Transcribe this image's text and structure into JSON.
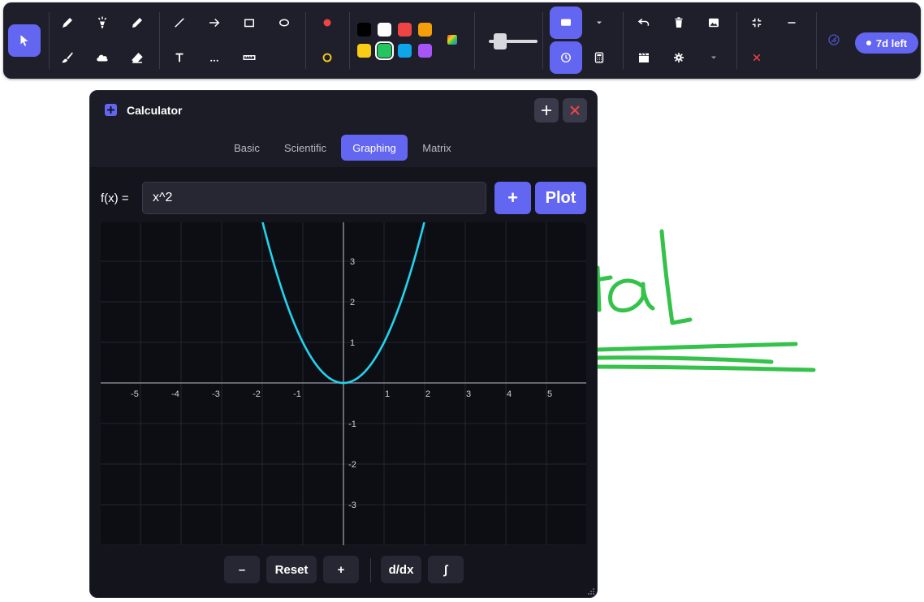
{
  "toolbar": {
    "tools": [
      "select-tool",
      "pen-tool",
      "highlighter-tool",
      "pencil-tool",
      "brush-tool",
      "cloud-tool",
      "eraser-tool",
      "line-tool",
      "arrow-tool",
      "rectangle-tool",
      "ellipse-tool",
      "text-tool",
      "dotted-tool",
      "ruler-tool"
    ],
    "colors": {
      "swatches": [
        "#000000",
        "#ffffff",
        "#ef4444",
        "#f59e0b",
        "#facc15",
        "#22c55e",
        "#0ea5e9",
        "#a855f7"
      ],
      "selected": "#22c55e",
      "accent": "#6366f1"
    },
    "stroke_width_level": 0.15,
    "trial_badge": "7d left"
  },
  "calculator": {
    "title": "Calculator",
    "tabs": [
      "Basic",
      "Scientific",
      "Graphing",
      "Matrix"
    ],
    "active_tab": "Graphing",
    "function_label": "f(x) =",
    "function_value": "x^2",
    "add_label": "+",
    "plot_label": "Plot",
    "controls": {
      "zoom_out": "–",
      "reset": "Reset",
      "zoom_in": "+",
      "derivative": "d/dx",
      "integral": "∫"
    }
  },
  "chart_data": {
    "type": "line",
    "function": "x^2",
    "series": [
      {
        "color": "#22d3ee",
        "x": [
          -2,
          -1.5,
          -1,
          -0.5,
          0,
          0.5,
          1,
          1.5,
          2
        ],
        "y": [
          4,
          2.25,
          1,
          0.25,
          0,
          0.25,
          1,
          2.25,
          4
        ]
      }
    ],
    "xlim": [
      -6,
      6
    ],
    "ylim": [
      -4,
      4
    ],
    "x_ticks": [
      "-5",
      "-4",
      "-3",
      "-2",
      "-1",
      "1",
      "2",
      "3",
      "4",
      "5"
    ],
    "y_ticks": [
      "3",
      "2",
      "1",
      "-1",
      "-2",
      "-3"
    ],
    "grid": true
  }
}
